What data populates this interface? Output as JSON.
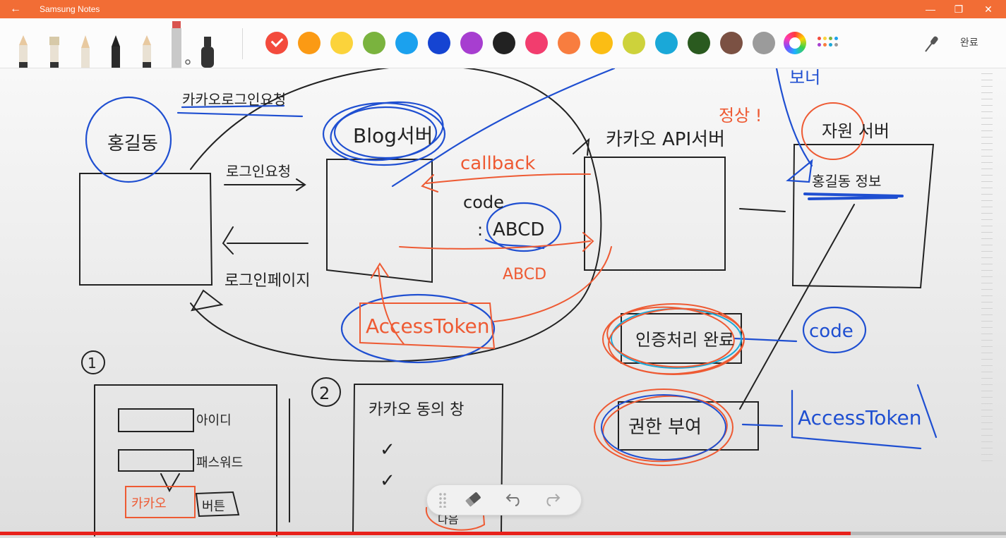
{
  "app": {
    "title": "Samsung Notes"
  },
  "window_controls": {
    "back": "←",
    "minimize": "—",
    "maximize": "❐",
    "close": "✕"
  },
  "toolbar": {
    "pens": [
      "pencil",
      "brush",
      "calligraphy",
      "fountain-pen",
      "pencil-2",
      "marker",
      "highlighter"
    ],
    "colors": [
      "#f34b3d",
      "#fb9a14",
      "#fbd33b",
      "#7ab33e",
      "#1ba1ee",
      "#1544d2",
      "#a73ed0",
      "#222222",
      "#f23d6e",
      "#f87d3f",
      "#fbbd14",
      "#cdd23b",
      "#1aa8d8",
      "#2a5a1f",
      "#7b5143",
      "#9b9b9b"
    ],
    "selected_color": "#f34b3d",
    "done_label": "완료"
  },
  "handwriting": {
    "hong_gildong": "홍길동",
    "kakao_login_request": "카카오로그인요청",
    "login_request": "로그인요청",
    "login_page": "로그인페이지",
    "blog_server": "Blog서버",
    "callback": "callback",
    "code_label": "code",
    "abcd": "ABCD",
    "abcd_arrow": "ABCD",
    "access_token": "AccessToken",
    "kakao_api_server": "카카오 API서버",
    "normal": "정상 !",
    "resource_owner_partial": "보너",
    "resource_server": "자원 서버",
    "hong_info": "홍길동 정보",
    "auth_done": "인증처리 완료",
    "code_box": "code",
    "grant": "권한 부여",
    "access_token_right": "AccessToken",
    "step1": "1",
    "step2": "2",
    "id_label": "아이디",
    "pw_label": "패스워드",
    "kakao_btn": "카카오",
    "btn_label": "버튼",
    "kakao_consent": "카카오 동의 창",
    "check1": "✓",
    "check2": "✓",
    "bottom_partial": "다음"
  },
  "bottom_tools": {
    "grip": "drag-handle",
    "eraser": "eraser",
    "undo": "undo",
    "redo": "redo"
  }
}
